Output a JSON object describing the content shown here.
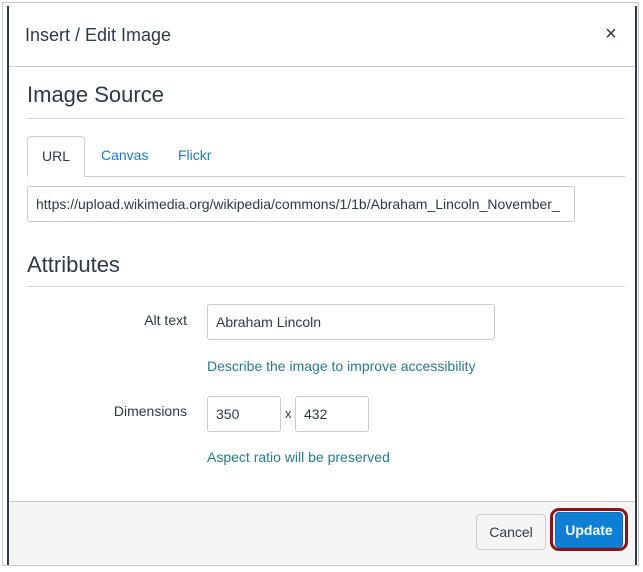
{
  "dialog": {
    "title": "Insert / Edit Image",
    "close_glyph": "×"
  },
  "image_source": {
    "heading": "Image Source",
    "tabs": [
      {
        "label": "URL",
        "active": true
      },
      {
        "label": "Canvas",
        "active": false
      },
      {
        "label": "Flickr",
        "active": false
      }
    ],
    "url_value": "https://upload.wikimedia.org/wikipedia/commons/1/1b/Abraham_Lincoln_November_"
  },
  "attributes": {
    "heading": "Attributes",
    "alt_label": "Alt text",
    "alt_value": "Abraham Lincoln",
    "alt_hint": "Describe the image to improve accessibility",
    "dimensions_label": "Dimensions",
    "width_value": "350",
    "times_glyph": "x",
    "height_value": "432",
    "dimensions_hint": "Aspect ratio will be preserved"
  },
  "footer": {
    "cancel_label": "Cancel",
    "update_label": "Update"
  },
  "colors": {
    "link": "#1f7bc1",
    "hint": "#2b7a8b",
    "primary": "#0e7fd4",
    "highlight_ring": "#8b1418"
  },
  "icons": {
    "close": "close-icon"
  }
}
